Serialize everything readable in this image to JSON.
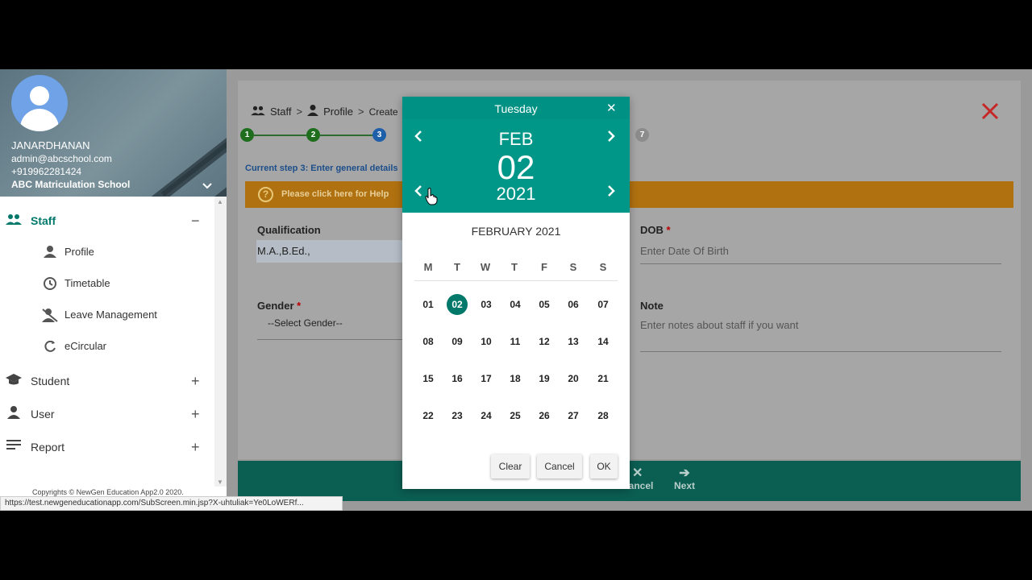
{
  "sidebar": {
    "user_name": "JANARDHANAN",
    "email": "admin@abcschool.com",
    "phone": "+919962281424",
    "school": "ABC Matriculation School",
    "items": [
      {
        "label": "Staff",
        "icon": "staff-icon",
        "toggle": "−"
      },
      {
        "label": "Student",
        "icon": "graduation-cap-icon",
        "toggle": "+"
      },
      {
        "label": "User",
        "icon": "person-icon",
        "toggle": "+"
      },
      {
        "label": "Report",
        "icon": "report-lines-icon",
        "toggle": "+"
      }
    ],
    "staff_sub": [
      {
        "label": "Profile",
        "icon": "person-icon"
      },
      {
        "label": "Timetable",
        "icon": "clock-icon"
      },
      {
        "label": "Leave Management",
        "icon": "leave-icon"
      },
      {
        "label": "eCircular",
        "icon": "refresh-icon"
      }
    ],
    "copyright": "Copyrights © NewGen Education App2.0 2020."
  },
  "status_url": "https://test.newgeneducationapp.com/SubScreen.min.jsp?X-uhtuliak=Ye0LoWERf...",
  "breadcrumb": {
    "staff": "Staff",
    "profile": "Profile",
    "create": "Create",
    "sep": ">"
  },
  "steps": [
    "1",
    "2",
    "3",
    "7"
  ],
  "current_step": "Current step 3: Enter general details",
  "help_text": "Please click here for Help",
  "form": {
    "qualification_label": "Qualification",
    "qualification_value": "M.A.,B.Ed.,",
    "dob_label": "DOB",
    "dob_placeholder": "Enter Date Of Birth",
    "gender_label": "Gender",
    "gender_value": "--Select Gender--",
    "note_label": "Note",
    "note_placeholder": "Enter notes about staff if you want",
    "required_mark": "*"
  },
  "footer": {
    "cancel": "Cancel",
    "next": "Next"
  },
  "datepicker": {
    "weekday": "Tuesday",
    "month": "FEB",
    "day": "02",
    "year": "2021",
    "caption": "FEBRUARY 2021",
    "dow": [
      "M",
      "T",
      "W",
      "T",
      "F",
      "S",
      "S"
    ],
    "weeks": [
      [
        "01",
        "02",
        "03",
        "04",
        "05",
        "06",
        "07"
      ],
      [
        "08",
        "09",
        "10",
        "11",
        "12",
        "13",
        "14"
      ],
      [
        "15",
        "16",
        "17",
        "18",
        "19",
        "20",
        "21"
      ],
      [
        "22",
        "23",
        "24",
        "25",
        "26",
        "27",
        "28"
      ]
    ],
    "selected": "02",
    "buttons": {
      "clear": "Clear",
      "cancel": "Cancel",
      "ok": "OK"
    }
  },
  "colors": {
    "teal": "#009688",
    "teal_dark": "#00796b",
    "close_red": "#c62828",
    "help_orange": "#b07110"
  }
}
